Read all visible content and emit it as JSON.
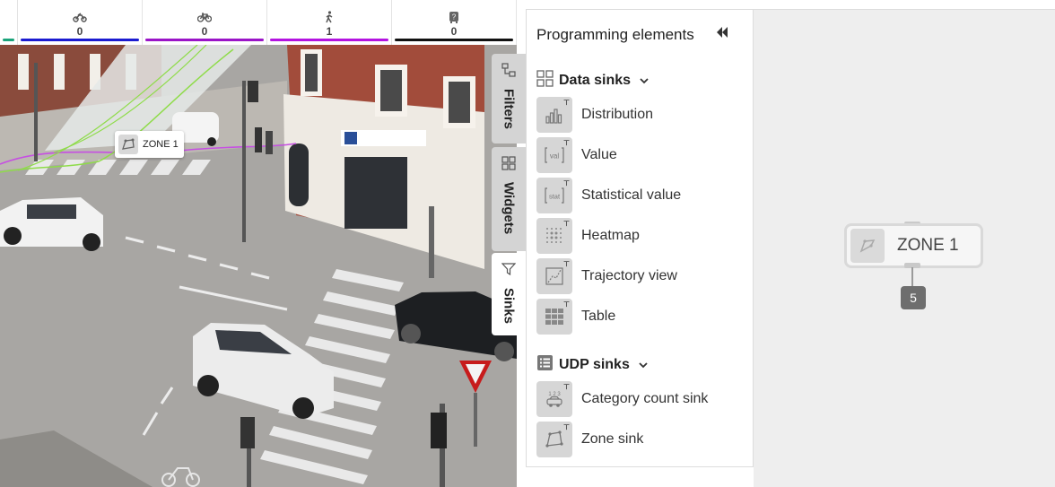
{
  "counters": [
    {
      "icon": "motorcycle-icon",
      "count": "0",
      "color": "#1b1bd0"
    },
    {
      "icon": "bicycle-icon",
      "count": "0",
      "color": "#9a14c7"
    },
    {
      "icon": "pedestrian-icon",
      "count": "1",
      "color": "#b313e0"
    },
    {
      "icon": "unknown-vehicle-icon",
      "count": "0",
      "color": "#111111"
    }
  ],
  "first_counter_color": "#1aa37a",
  "zone_overlay": {
    "label": "ZONE 1",
    "icon": "zone-icon"
  },
  "side_tabs": [
    {
      "label": "Filters",
      "icon": "filters-icon"
    },
    {
      "label": "Widgets",
      "icon": "widgets-icon"
    },
    {
      "label": "Sinks",
      "icon": "funnel-icon"
    }
  ],
  "panel": {
    "title": "Programming elements",
    "collapse_icon": "double-chevron-left-icon",
    "sections": [
      {
        "title": "Data sinks",
        "icon": "grid-icon",
        "items": [
          {
            "label": "Distribution",
            "icon": "bar-chart-icon"
          },
          {
            "label": "Value",
            "icon": "value-icon"
          },
          {
            "label": "Statistical value",
            "icon": "stat-icon"
          },
          {
            "label": "Heatmap",
            "icon": "heatmap-icon"
          },
          {
            "label": "Trajectory view",
            "icon": "trajectory-icon"
          },
          {
            "label": "Table",
            "icon": "table-icon"
          }
        ]
      },
      {
        "title": "UDP sinks",
        "icon": "list-icon",
        "items": [
          {
            "label": "Category count sink",
            "icon": "category-count-icon"
          },
          {
            "label": "Zone sink",
            "icon": "zone-sink-icon"
          }
        ]
      }
    ]
  },
  "canvas": {
    "node": {
      "label": "ZONE 1",
      "icon": "zone-icon"
    },
    "output_count": "5"
  },
  "colors": {
    "zone_fill": "#e3e7e6",
    "track_green": "#8fdc4a",
    "track_magenta": "#c64fe2"
  }
}
